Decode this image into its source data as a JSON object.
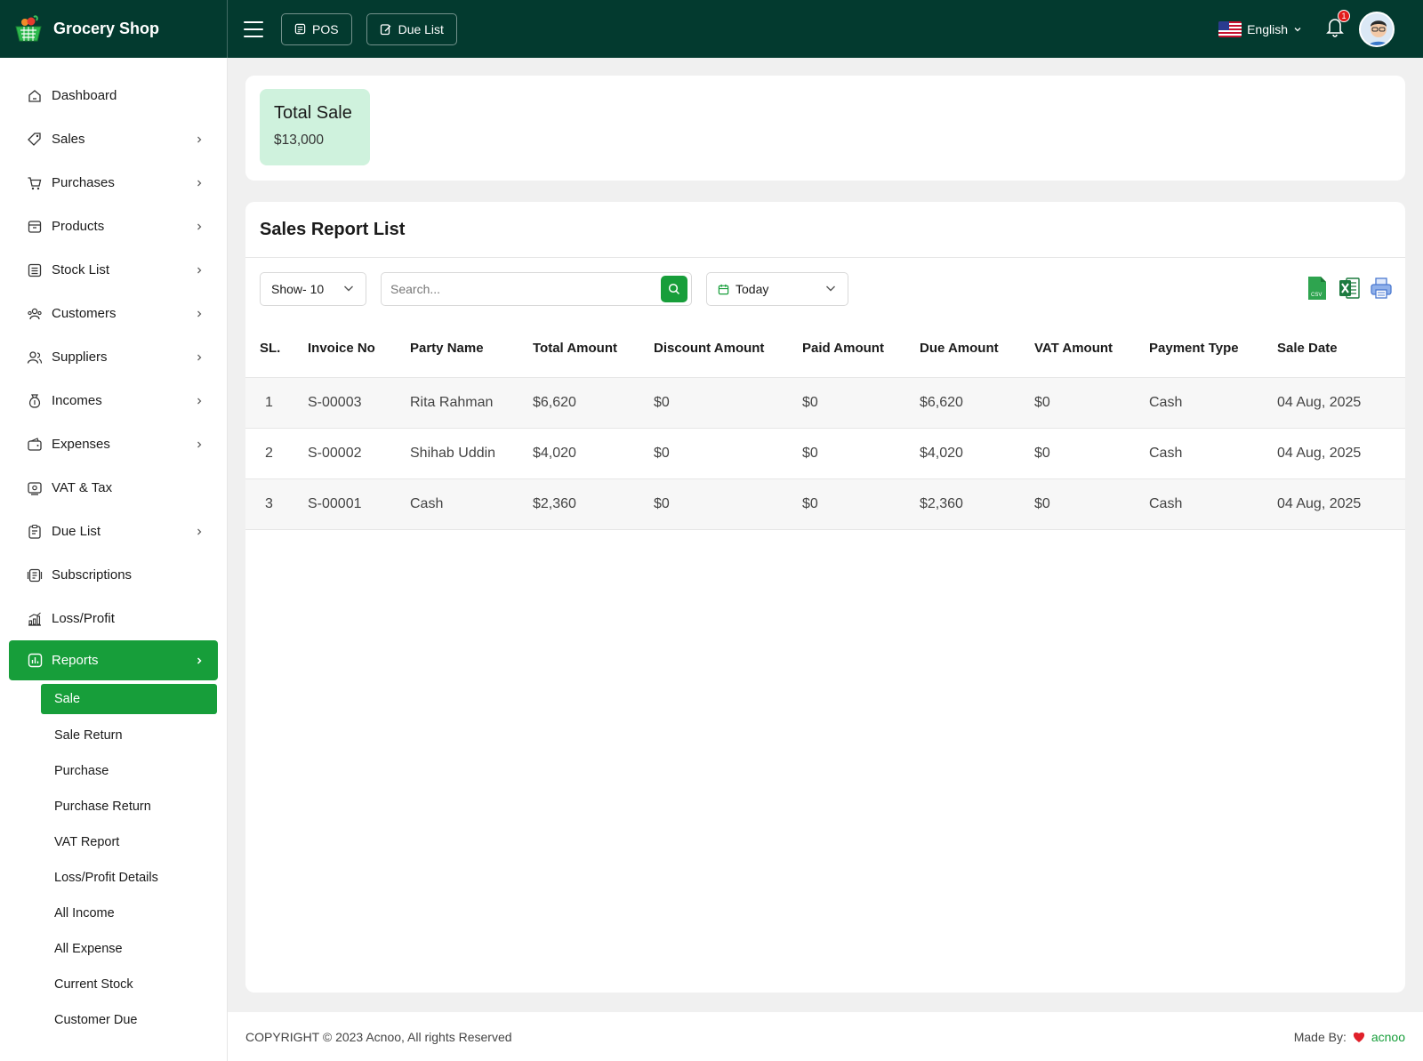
{
  "app": {
    "name": "Grocery Shop"
  },
  "header": {
    "pos_label": "POS",
    "due_list_label": "Due List",
    "language": "English",
    "notification_count": "1"
  },
  "sidebar": {
    "items": [
      {
        "label": "Dashboard",
        "icon": "dashboard-icon",
        "has_children": false
      },
      {
        "label": "Sales",
        "icon": "tag-icon",
        "has_children": true
      },
      {
        "label": "Purchases",
        "icon": "cart-icon",
        "has_children": true
      },
      {
        "label": "Products",
        "icon": "box-icon",
        "has_children": true
      },
      {
        "label": "Stock List",
        "icon": "list-icon",
        "has_children": true
      },
      {
        "label": "Customers",
        "icon": "users-icon",
        "has_children": true
      },
      {
        "label": "Suppliers",
        "icon": "supplier-icon",
        "has_children": true
      },
      {
        "label": "Incomes",
        "icon": "money-bag-icon",
        "has_children": true
      },
      {
        "label": "Expenses",
        "icon": "wallet-icon",
        "has_children": true
      },
      {
        "label": "VAT & Tax",
        "icon": "receipt-icon",
        "has_children": false
      },
      {
        "label": "Due List",
        "icon": "clipboard-icon",
        "has_children": true
      },
      {
        "label": "Subscriptions",
        "icon": "subscription-icon",
        "has_children": false
      },
      {
        "label": "Loss/Profit",
        "icon": "chart-icon",
        "has_children": false
      }
    ],
    "active_item": {
      "label": "Reports",
      "icon": "report-icon"
    },
    "report_subitems": [
      "Sale",
      "Sale Return",
      "Purchase",
      "Purchase Return",
      "VAT Report",
      "Loss/Profit Details",
      "All Income",
      "All Expense",
      "Current Stock",
      "Customer Due"
    ],
    "active_subitem": "Sale"
  },
  "summary": {
    "label": "Total Sale",
    "value": "$13,000"
  },
  "report": {
    "title": "Sales Report List",
    "show_label": "Show- 10",
    "search_placeholder": "Search...",
    "date_filter": "Today",
    "columns": [
      "SL.",
      "Invoice No",
      "Party Name",
      "Total Amount",
      "Discount Amount",
      "Paid Amount",
      "Due Amount",
      "VAT Amount",
      "Payment Type",
      "Sale Date"
    ],
    "rows": [
      [
        "1",
        "S-00003",
        "Rita Rahman",
        "$6,620",
        "$0",
        "$0",
        "$6,620",
        "$0",
        "Cash",
        "04 Aug, 2025"
      ],
      [
        "2",
        "S-00002",
        "Shihab Uddin",
        "$4,020",
        "$0",
        "$0",
        "$4,020",
        "$0",
        "Cash",
        "04 Aug, 2025"
      ],
      [
        "3",
        "S-00001",
        "Cash",
        "$2,360",
        "$0",
        "$0",
        "$2,360",
        "$0",
        "Cash",
        "04 Aug, 2025"
      ]
    ]
  },
  "footer": {
    "copyright": "COPYRIGHT © 2023 Acnoo, All rights Reserved",
    "made_by_label": "Made By:",
    "made_by_brand": "acnoo"
  },
  "colors": {
    "accent": "#179e3a",
    "header_bg": "#033a2f",
    "summary_bg": "#cff2dd"
  }
}
